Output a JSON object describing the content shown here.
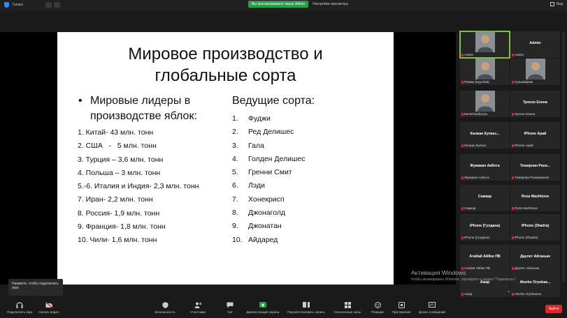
{
  "topbar": {
    "window_title": "Тапако",
    "banner": "Вы просматриваете экран Admin",
    "settings": "Настройки просмотра",
    "view": "Вид"
  },
  "slide": {
    "title_line1": "Мировое производство и",
    "title_line2": "глобальные сорта",
    "left_heading": "Мировые лидеры в производстве яблок:",
    "left_items": [
      "1. Китай- 43 млн. тонн",
      "2. США   -   5 млн. тонн",
      "3. Турция – 3,6 млн. тонн",
      "4. Польша – 3 млн. тонн",
      "5.-6. Италия и Индия- 2,3 млн. тонн",
      "7. Иран- 2,2 млн. тонн",
      "8. Россия- 1,9 млн. тонн",
      "9. Франция- 1,8 млн. тонн",
      "10. Чили- 1,6 млн. тонн"
    ],
    "right_heading": "Ведущие сорта:",
    "right_items": [
      {
        "num": "1.",
        "name": "Фуджи"
      },
      {
        "num": "2.",
        "name": "Ред Делишес"
      },
      {
        "num": "3.",
        "name": "Гала"
      },
      {
        "num": "4.",
        "name": "Голден Делишес"
      },
      {
        "num": "5.",
        "name": "Гренни Смит"
      },
      {
        "num": "6.",
        "name": "Лэди"
      },
      {
        "num": "7.",
        "name": "Хонекрисп"
      },
      {
        "num": "8.",
        "name": "Джонаголд"
      },
      {
        "num": "9.",
        "name": "Джонатан"
      },
      {
        "num": "10.",
        "name": "Айдаред"
      }
    ]
  },
  "participants": [
    {
      "name": "",
      "label": "Admin",
      "photo": true,
      "active": true
    },
    {
      "name": "Admin",
      "label": "Admin",
      "photo": false
    },
    {
      "name": "",
      "label": "Режим (Курсбай)",
      "photo": true
    },
    {
      "name": "",
      "label": "Гульмайрам",
      "photo": true
    },
    {
      "name": "",
      "label": "Кичей Бибигуль",
      "photo": true
    },
    {
      "name": "Троско Елена",
      "label": "Троско Елена",
      "photo": false
    },
    {
      "name": "Калиан  Кулказ...",
      "label": "Калиан Кулказ",
      "photo": false
    },
    {
      "name": "IPhone Арай",
      "label": "IPhone Арай",
      "photo": false
    },
    {
      "name": "Жумакан Акбота",
      "label": "Жумакан Акбота",
      "photo": false
    },
    {
      "name": "Темирлан  Рахи...",
      "label": "Темирлан Рахимжанов",
      "photo": false
    },
    {
      "name": "Самкар",
      "label": "Самкар",
      "photo": false
    },
    {
      "name": "Roza Mazhitova",
      "label": "Roza Mazhitova",
      "photo": false
    },
    {
      "name": "iPhone (Гулдана)",
      "label": "iPhone (Гулдана)",
      "photo": false
    },
    {
      "name": "iPhone (Zhadra)",
      "label": "iPhone (Zhadra)",
      "photo": false
    },
    {
      "name": "Атабай  Айбек ПВ",
      "label": "Атабай Айбек ПВ",
      "photo": false
    },
    {
      "name": "Даулет Айганым",
      "label": "Даулет Айганым",
      "photo": false
    },
    {
      "name": "Ажар",
      "label": "Ажар",
      "photo": false
    },
    {
      "name": "Akerke  Orynbae...",
      "label": "Akerke Orynbaeva",
      "photo": false
    }
  ],
  "activation": {
    "title": "Активация Windows",
    "subtitle": "Чтобы активировать Windows, перейдите в раздел \"Параметры\"."
  },
  "tooltip": "Нажмите, чтобы подключить звук",
  "toolbar": {
    "unmute": "Подключить звук",
    "start_video": "Начать видео",
    "security": "Безопасность",
    "participants": "Участники",
    "participants_count": "20",
    "chat": "Чат",
    "share": "Демонстрация экрана",
    "pause": "Пауза/остановить запись",
    "breakout": "Сессионные залы",
    "reactions": "Реакции",
    "apps": "Приложения",
    "whiteboards": "Доски сообщений",
    "end": "Выйти"
  }
}
